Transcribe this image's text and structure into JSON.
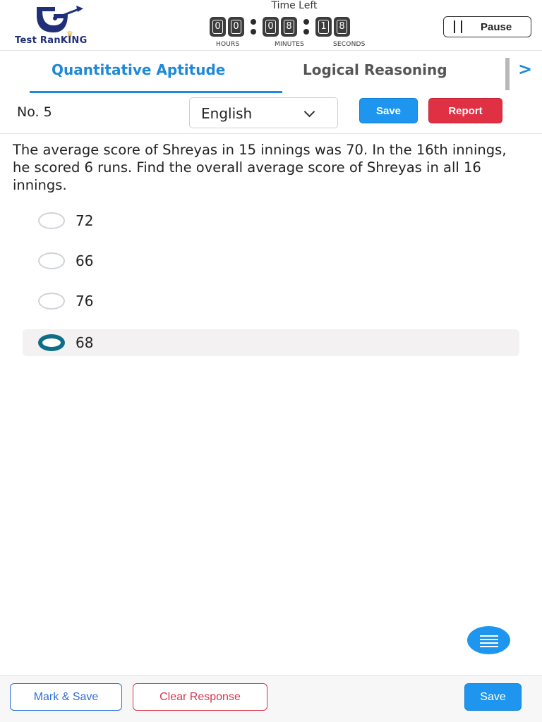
{
  "header": {
    "logo_text": "Test RanKING",
    "timer_title": "Time Left",
    "timer": {
      "hours": [
        "0",
        "0"
      ],
      "minutes": [
        "0",
        "8"
      ],
      "seconds": [
        "1",
        "8"
      ],
      "labels": {
        "hours": "HOURS",
        "minutes": "MINUTES",
        "seconds": "SECONDS"
      }
    },
    "pause_label": "Pause"
  },
  "tabs": [
    {
      "label": "Quantitative Aptitude",
      "active": true
    },
    {
      "label": "Logical Reasoning",
      "active": false
    }
  ],
  "question_bar": {
    "number": "No. 5",
    "language": "English",
    "save_label": "Save",
    "report_label": "Report"
  },
  "question": {
    "text": "The average score of Shreyas in 15 innings was 70. In the 16th innings, he scored 6 runs. Find the overall average score of Shreyas in all 16 innings.",
    "options": [
      "72",
      "66",
      "76",
      "68"
    ],
    "selected_index": 3
  },
  "footer": {
    "mark_save": "Mark & Save",
    "clear_response": "Clear Response",
    "save": "Save"
  },
  "colors": {
    "accent": "#1e96f0",
    "danger": "#df3044",
    "selected_radio": "#0f6e87"
  }
}
